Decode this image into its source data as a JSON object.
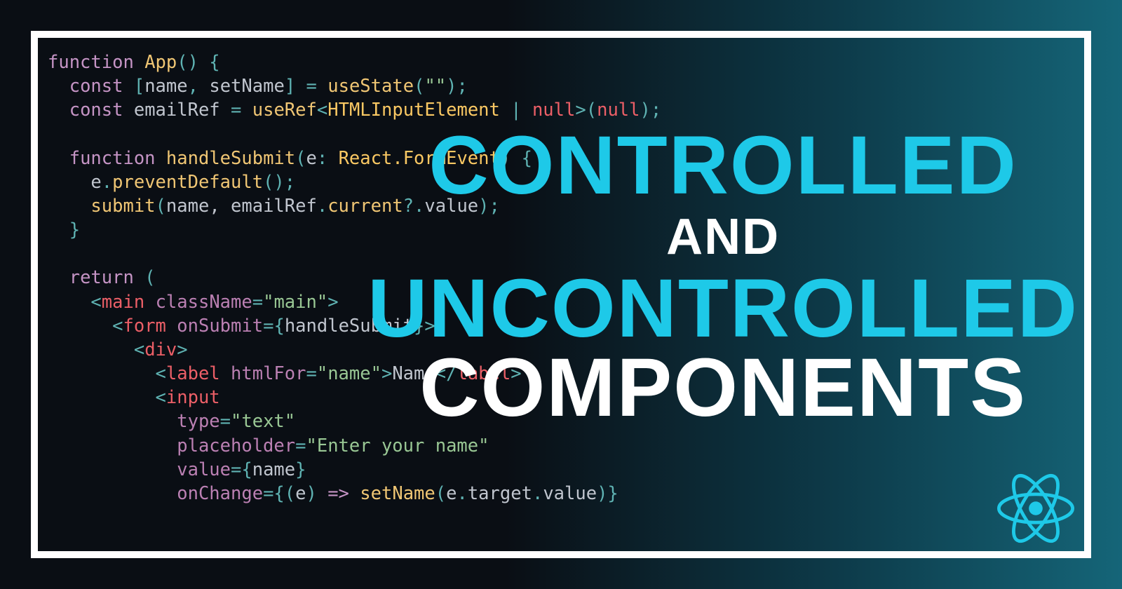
{
  "headline": {
    "line1": "CONTROLLED",
    "line2": "AND",
    "line3": "UNCONTROLLED",
    "line4": "COMPONENTS"
  },
  "colors": {
    "accent": "#1ec9e8",
    "white": "#ffffff"
  },
  "code": {
    "l01_kw": "function",
    "l01_fn": "App",
    "l01_rest": "() {",
    "l02_kw": "const",
    "l02_names": "[name, setName]",
    "l02_eq": "=",
    "l02_call": "useState",
    "l02_arg": "\"\"",
    "l03_kw": "const",
    "l03_var": "emailRef",
    "l03_eq": "=",
    "l03_call": "useRef",
    "l03_type": "HTMLInputElement",
    "l03_pipe": "|",
    "l03_null1": "null",
    "l03_null2": "null",
    "l05_kw": "function",
    "l05_fn": "handleSubmit",
    "l05_param": "e",
    "l05_ptype": "React.FormEvent",
    "l06_obj": "e",
    "l06_method": "preventDefault",
    "l07_call": "submit",
    "l07_args": "name, emailRef",
    "l07_chain": "current",
    "l07_value": "value",
    "l10_kw": "return",
    "l11_tag": "main",
    "l11_attr": "className",
    "l11_val": "\"main\"",
    "l12_tag": "form",
    "l12_attr": "onSubmit",
    "l12_val": "handleSubmit",
    "l13_tag": "div",
    "l14_tag": "label",
    "l14_attr": "htmlFor",
    "l14_val": "\"name\"",
    "l14_text": "Name",
    "l15_tag": "input",
    "l16_attr": "type",
    "l16_val": "\"text\"",
    "l17_attr": "placeholder",
    "l17_val": "\"Enter your name\"",
    "l18_attr": "value",
    "l18_val": "name",
    "l19_attr": "onChange",
    "l19_param": "e",
    "l19_arrow": "=>",
    "l19_fn": "setName",
    "l19_chain1": "e",
    "l19_chain2": "target",
    "l19_chain3": "value"
  }
}
